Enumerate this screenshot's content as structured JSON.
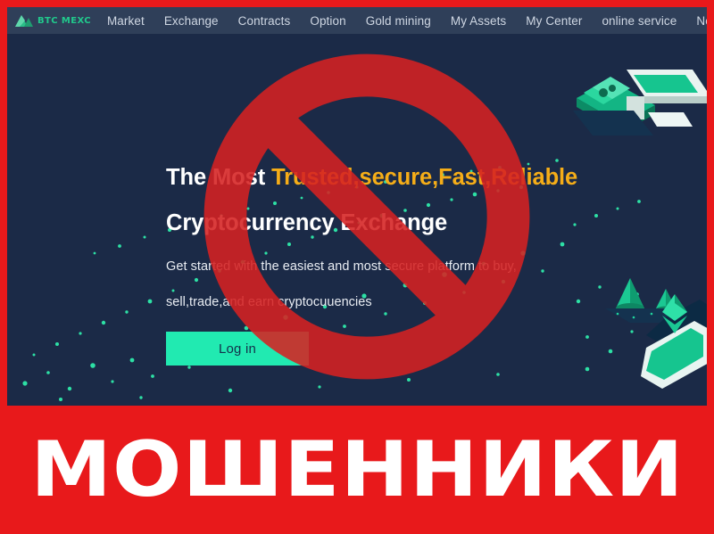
{
  "page": {
    "background_color": "#1b2a47",
    "frame_color": "#e8191b"
  },
  "navbar": {
    "background_color": "#2f3f59",
    "logo": {
      "icon": "mountain-logo-icon",
      "text": "BTC MEXC",
      "color": "#21c98c"
    },
    "items": [
      {
        "label": "Market"
      },
      {
        "label": "Exchange"
      },
      {
        "label": "Contracts"
      },
      {
        "label": "Option"
      },
      {
        "label": "Gold mining"
      },
      {
        "label": "My Assets"
      },
      {
        "label": "My Center"
      },
      {
        "label": "online service"
      },
      {
        "label": "New currenc"
      }
    ]
  },
  "hero": {
    "headline": {
      "lead": "The Most ",
      "accent": "Trusted,secure,Fast,Reliable",
      "line2": "Cryptocurrency Exchange",
      "accent_color": "#f5ad18",
      "text_color": "#ffffff"
    },
    "subtitle_line1": "Get started with the easiest and most secure platform to buy,",
    "subtitle_line2": "sell,trade,and earn cryptocuuencies",
    "cta": {
      "label": "Log in",
      "background_color": "#21eab1",
      "text_color": "#14304a"
    },
    "artwork": {
      "name": "isometric-crypto-illustration",
      "accent_color": "#21c98c",
      "dots_color": "#2de0a5"
    }
  },
  "overlay": {
    "prohibition_sign": {
      "name": "prohibition-sign",
      "color": "#d62222"
    }
  },
  "scam_banner": {
    "text": "МОШЕННИКИ",
    "background_color": "#e8191b",
    "text_color": "#ffffff"
  }
}
